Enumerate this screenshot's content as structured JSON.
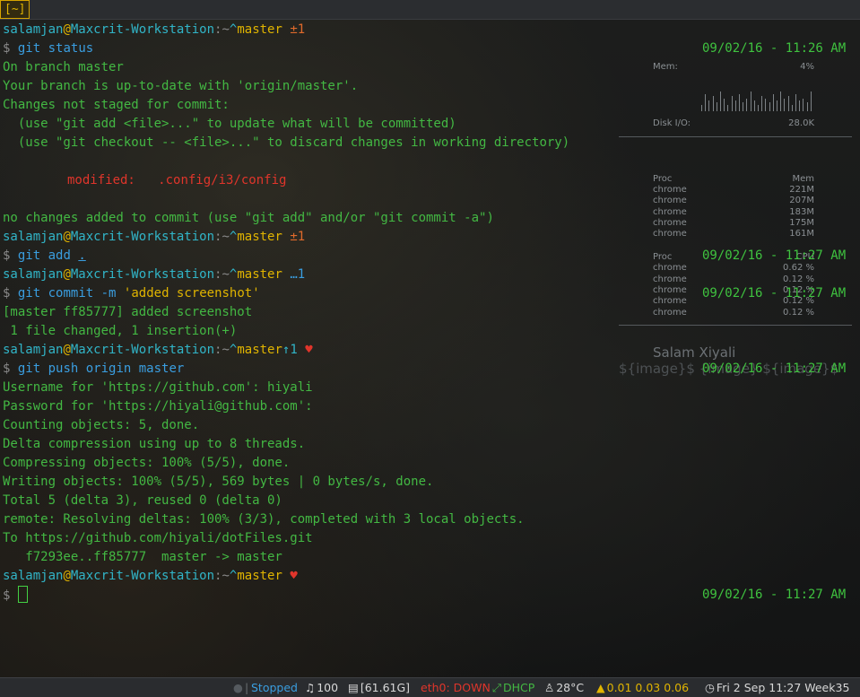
{
  "window": {
    "workspace_tag": "[~]"
  },
  "terminal": {
    "prompt": {
      "user": "salamjan",
      "at": "@",
      "host": "Maxcrit-Workstation",
      "sep": ":",
      "path": "~",
      "caret": "^",
      "branch": "master",
      "dollar": "$"
    },
    "block1": {
      "status_flag": "±1",
      "cmd": "git",
      "arg": "status",
      "out": [
        "On branch master",
        "Your branch is up-to-date with 'origin/master'.",
        "Changes not staged for commit:",
        "  (use \"git add <file>...\" to update what will be committed)",
        "  (use \"git checkout -- <file>...\" to discard changes in working directory)"
      ],
      "modified_label": "modified:",
      "modified_file": ".config/i3/config",
      "summary": "no changes added to commit (use \"git add\" and/or \"git commit -a\")"
    },
    "block2": {
      "status_flag": "±1",
      "cmd": "git",
      "arg": "add",
      "arg2": "."
    },
    "block3": {
      "status_flag": "…1",
      "cmd": "git",
      "arg": "commit",
      "flag": "-m",
      "message": "'added screenshot'",
      "out": [
        "[master ff85777] added screenshot",
        " 1 file changed, 1 insertion(+)"
      ]
    },
    "block4": {
      "status_flag": "↑1",
      "heart": "♥",
      "cmd": "git",
      "arg": "push origin master",
      "out": [
        "Username for 'https://github.com': hiyali",
        "Password for 'https://hiyali@github.com':",
        "Counting objects: 5, done.",
        "Delta compression using up to 8 threads.",
        "Compressing objects: 100% (5/5), done.",
        "Writing objects: 100% (5/5), 569 bytes | 0 bytes/s, done.",
        "Total 5 (delta 3), reused 0 (delta 0)",
        "remote: Resolving deltas: 100% (3/3), completed with 3 local objects.",
        "To https://github.com/hiyali/dotFiles.git",
        "   f7293ee..ff85777  master -> master"
      ]
    },
    "block5": {
      "heart": "♥"
    },
    "timestamps": [
      "09/02/16 - 11:26 AM",
      "09/02/16 - 11:27 AM",
      "09/02/16 - 11:27 AM",
      "09/02/16 - 11:27 AM",
      "09/02/16 - 11:27 AM"
    ]
  },
  "conky": {
    "mem_label": "Mem:",
    "mem_value": "4%",
    "disk_label": "Disk I/O:",
    "disk_value": "28.0K",
    "mem_bars": [
      0.3,
      0.8,
      0.5,
      0.7,
      0.4,
      0.9,
      0.6,
      0.3,
      0.7,
      0.5,
      0.8,
      0.4,
      0.6,
      0.9,
      0.5,
      0.3,
      0.7,
      0.6,
      0.4,
      0.8,
      0.5,
      0.9,
      0.6,
      0.7,
      0.3,
      0.8,
      0.5,
      0.6,
      0.4,
      0.9
    ],
    "proc_mem": {
      "h_left": "Proc",
      "h_right": "Mem",
      "rows": [
        {
          "name": "chrome",
          "value": "221M"
        },
        {
          "name": "chrome",
          "value": "207M"
        },
        {
          "name": "chrome",
          "value": "183M"
        },
        {
          "name": "chrome",
          "value": "175M"
        },
        {
          "name": "chrome",
          "value": "161M"
        }
      ]
    },
    "proc_cpu": {
      "h_left": "Proc",
      "h_right": "CPU",
      "rows": [
        {
          "name": "chrome",
          "value": "0.62 %"
        },
        {
          "name": "chrome",
          "value": "0.12 %"
        },
        {
          "name": "chrome",
          "value": "0.12 %"
        },
        {
          "name": "chrome",
          "value": "0.12 %"
        },
        {
          "name": "chrome",
          "value": "0.12 %"
        }
      ]
    },
    "name": "Salam Xiyali",
    "image_placeholder": "${image}$ {image} ${image}$"
  },
  "statusbar": {
    "player_state": "Stopped",
    "volume_icon": "music-note-icon",
    "volume": "100",
    "disk_icon": "database-icon",
    "disk": "[61.61G]",
    "eth": "eth0: DOWN",
    "wifi_icon": "network-icon",
    "wifi": "DHCP",
    "temp_icon": "linux-icon",
    "temp": "28°C",
    "load_icon": "chart-icon",
    "load": "0.01 0.03 0.06",
    "clock_icon": "clock-icon",
    "clock": "Fri 2 Sep 11:27 Week35",
    "colors": {
      "stopped": "#3a9ee0",
      "down": "#e0352b",
      "dhcp": "#43b843",
      "load": "#e0b400",
      "text": "#d8d8d8"
    }
  }
}
